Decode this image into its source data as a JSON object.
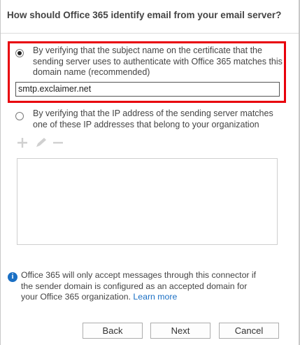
{
  "header": {
    "title": "How should Office 365 identify email from your email server?"
  },
  "options": [
    {
      "line1": "By verifying that the subject name on the certificate that the",
      "line2": "sending server uses to authenticate with Office 365 matches this",
      "line3": "domain name (recommended)",
      "selected": true
    },
    {
      "line1": "By verifying that the IP address of the sending server matches",
      "line2": "one of these IP addresses that belong to your organization",
      "selected": false
    }
  ],
  "domain_input": {
    "value": "smtp.exclaimer.net"
  },
  "toolbar": {
    "add_icon": "plus-icon",
    "edit_icon": "pencil-icon",
    "remove_icon": "minus-icon"
  },
  "info": {
    "line1": "Office 365 will only accept messages through this connector if",
    "line2": "the sender domain is configured as an accepted domain for",
    "line3_prefix": "your Office 365 organization.",
    "link": "Learn more"
  },
  "buttons": {
    "back": "Back",
    "next": "Next",
    "cancel": "Cancel"
  },
  "colors": {
    "highlight": "#e8000b",
    "link": "#1a6fc4",
    "info_icon": "#1a6fc4"
  }
}
